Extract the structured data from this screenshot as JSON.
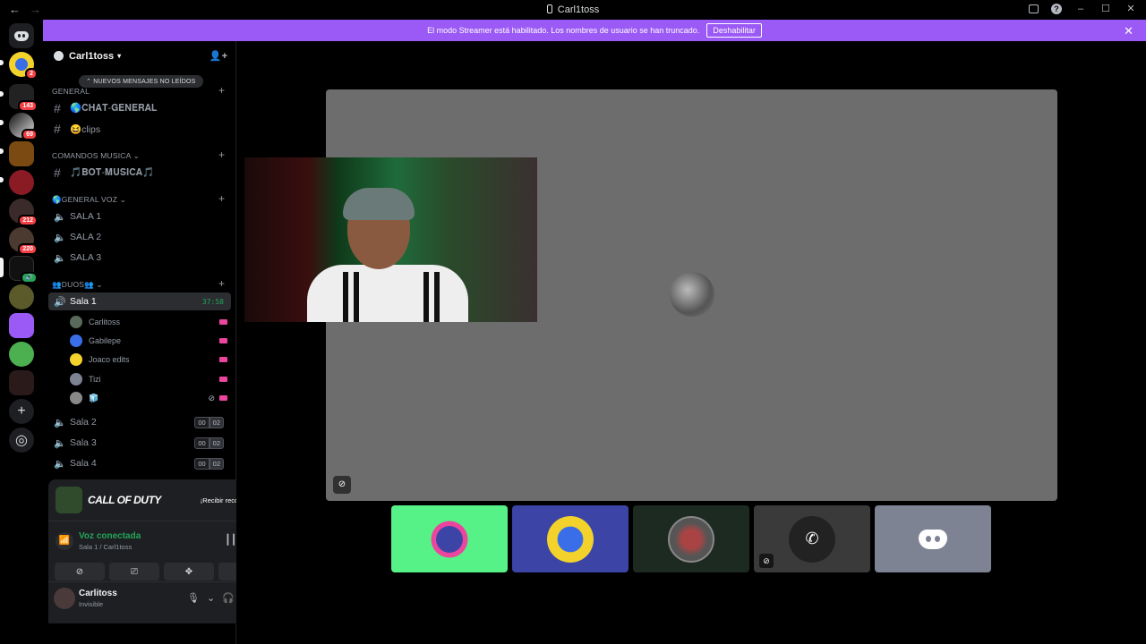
{
  "window": {
    "title": "Carl1toss",
    "nav_back": "←",
    "nav_forward": "→",
    "help_icon": "?",
    "minimize": "–",
    "maximize": "☐",
    "close": "✕"
  },
  "banner": {
    "text": "El modo Streamer está habilitado. Los nombres de usuario se han truncado.",
    "button": "Deshabilitar",
    "close": "✕"
  },
  "guild_badges": [
    "2",
    "143",
    "69",
    "212",
    "220"
  ],
  "server": {
    "name": "Carl1toss",
    "chevron": "▾",
    "invite": "👤+",
    "unread_pill": "⌃ NUEVOS MENSAJES NO LEÍDOS"
  },
  "categories": {
    "general": "GENERAL",
    "comandos": "COMANDOS MUSICA ⌄",
    "general_voz": "🌎GENERAL VOZ ⌄",
    "duos": "👥DUOS👥 ⌄"
  },
  "channels": {
    "chat_general": "🌎𝐂𝐇𝐀𝐓-𝐆𝐄𝐍𝐄𝐑𝐀𝐋",
    "clips": "😆clips",
    "bot_musica": "🎵𝐁𝐎𝐓-𝐌𝐔𝐒𝐈𝐂𝐀🎵",
    "sala1_voz": "SALA 1",
    "sala2_voz": "SALA 2",
    "sala3_voz": "SALA 3",
    "duo_sala1": "Sala 1",
    "duo_sala1_timer": "37:58",
    "duo_sala2": "Sala 2",
    "duo_sala3": "Sala 3",
    "duo_sala4": "Sala 4",
    "count_a": "00",
    "count_b": "02"
  },
  "members": [
    "Carlitoss",
    "Gabilepe",
    "Joaco edits",
    "Tizi",
    "🧊"
  ],
  "promo": {
    "title": "CALL OF DUTY",
    "button": "¡Recibir recompensa!"
  },
  "voice": {
    "status": "Voz conectada",
    "location": "Sala 1 / Carl1toss"
  },
  "user": {
    "name": "Carlitoss",
    "status": "Invisible"
  },
  "colors": {
    "accent_banner": "#9b59f5",
    "connected": "#23a55a",
    "live": "#eb459e",
    "thumb_green": "#57f287",
    "thumb_blue": "#3c45a5",
    "thumb_dark": "#1d2a22",
    "thumb_gray": "#3a3a3a",
    "thumb_slate": "#7e8394"
  }
}
